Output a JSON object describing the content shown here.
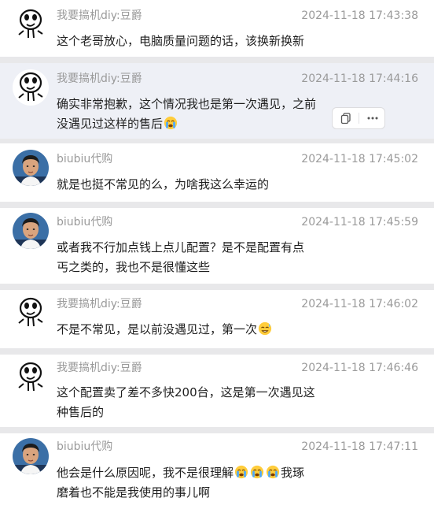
{
  "messages": [
    {
      "sender": "我要搞机diy:豆爵",
      "time": "2024-11-18 17:43:38",
      "lines": [
        "这个老哥放心，电脑质量问题的话，该换新换新"
      ]
    },
    {
      "sender": "我要搞机diy:豆爵",
      "time": "2024-11-18 17:44:16",
      "lines": [
        "确实非常抱歉，这个情况我也是第一次遇见，之前",
        "没遇见过这样的售后"
      ],
      "emoji_after": "crying-emoji"
    },
    {
      "sender": "biubiu代购",
      "time": "2024-11-18 17:45:02",
      "lines": [
        "就是也挺不常见的么，为啥我这么幸运的"
      ]
    },
    {
      "sender": "biubiu代购",
      "time": "2024-11-18 17:45:59",
      "lines": [
        "或者我不行加点钱上点儿配置？是不是配置有点",
        "丐之类的，我也不是很懂这些"
      ]
    },
    {
      "sender": "我要搞机diy:豆爵",
      "time": "2024-11-18 17:46:02",
      "lines": [
        "不是不常见，是以前没遇见过，第一次"
      ],
      "emoji_after": "sweat-smile-emoji"
    },
    {
      "sender": "我要搞机diy:豆爵",
      "time": "2024-11-18 17:46:46",
      "lines": [
        "这个配置卖了差不多快200台，这是第一次遇见这",
        "种售后的"
      ]
    },
    {
      "sender": "biubiu代购",
      "time": "2024-11-18 17:47:11",
      "lines_part1": "他会是什么原因呢，我不是很理解",
      "lines_part2": "我琢",
      "line2": "磨着也不能是我使用的事儿啊",
      "emojis": [
        "crying-emoji",
        "crying-emoji",
        "crying-emoji"
      ]
    }
  ],
  "actions": {
    "copy_icon": "copy-icon",
    "more_icon": "more-icon"
  },
  "colors": {
    "highlight_bg": "#eef0f6",
    "text": "#1f1f1f",
    "meta": "#9a9a9a"
  }
}
